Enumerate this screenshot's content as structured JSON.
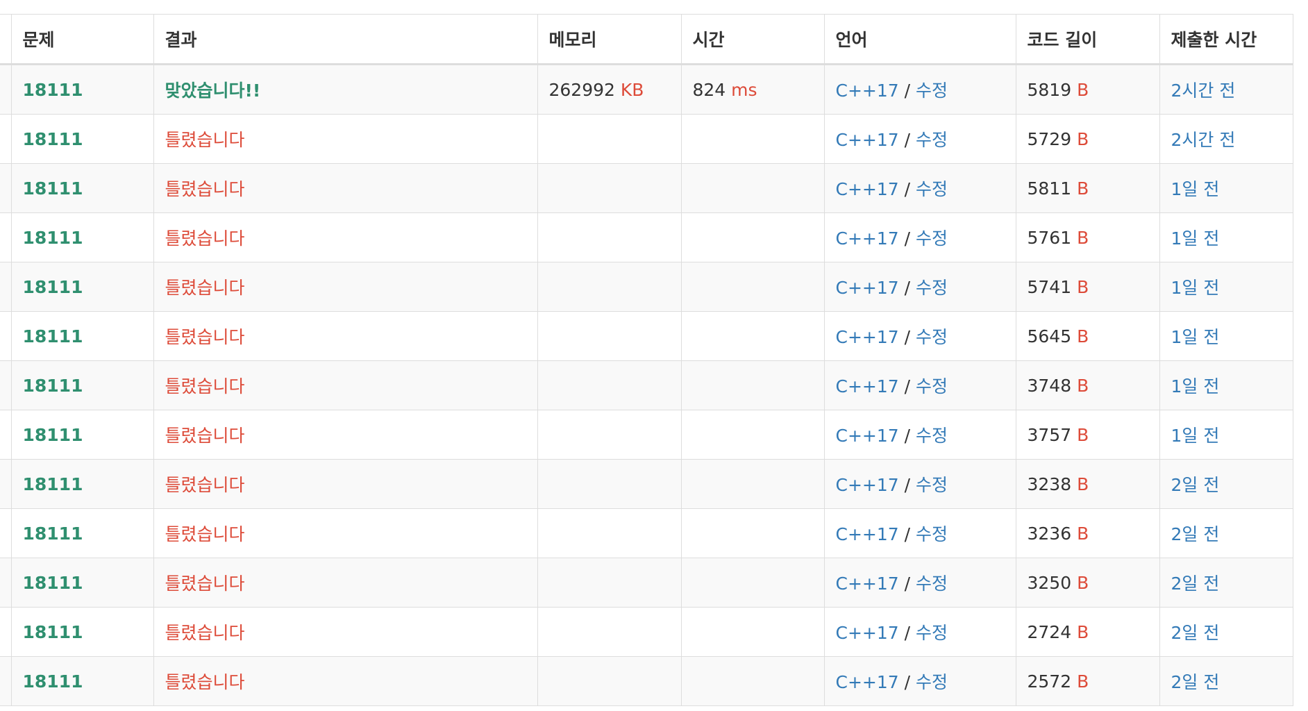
{
  "headers": [
    "",
    "문제",
    "결과",
    "메모리",
    "시간",
    "언어",
    "코드 길이",
    "제출한 시간"
  ],
  "colors": {
    "accent_green": "#2f8f6f",
    "error_red": "#dd4b39",
    "link_blue": "#337ab7",
    "border": "#dddddd",
    "stripe": "#f9f9f9"
  },
  "rows": [
    {
      "problem": "18111",
      "result": "맞았습니다!!",
      "status": "accepted",
      "memory": "262992",
      "memory_unit": "KB",
      "time": "824",
      "time_unit": "ms",
      "language": "C++17",
      "separator": "/",
      "edit": "수정",
      "code_length": "5819",
      "code_unit": "B",
      "submitted": "2시간 전"
    },
    {
      "problem": "18111",
      "result": "틀렸습니다",
      "status": "wrong",
      "memory": "",
      "memory_unit": "",
      "time": "",
      "time_unit": "",
      "language": "C++17",
      "separator": "/",
      "edit": "수정",
      "code_length": "5729",
      "code_unit": "B",
      "submitted": "2시간 전"
    },
    {
      "problem": "18111",
      "result": "틀렸습니다",
      "status": "wrong",
      "memory": "",
      "memory_unit": "",
      "time": "",
      "time_unit": "",
      "language": "C++17",
      "separator": "/",
      "edit": "수정",
      "code_length": "5811",
      "code_unit": "B",
      "submitted": "1일 전"
    },
    {
      "problem": "18111",
      "result": "틀렸습니다",
      "status": "wrong",
      "memory": "",
      "memory_unit": "",
      "time": "",
      "time_unit": "",
      "language": "C++17",
      "separator": "/",
      "edit": "수정",
      "code_length": "5761",
      "code_unit": "B",
      "submitted": "1일 전"
    },
    {
      "problem": "18111",
      "result": "틀렸습니다",
      "status": "wrong",
      "memory": "",
      "memory_unit": "",
      "time": "",
      "time_unit": "",
      "language": "C++17",
      "separator": "/",
      "edit": "수정",
      "code_length": "5741",
      "code_unit": "B",
      "submitted": "1일 전"
    },
    {
      "problem": "18111",
      "result": "틀렸습니다",
      "status": "wrong",
      "memory": "",
      "memory_unit": "",
      "time": "",
      "time_unit": "",
      "language": "C++17",
      "separator": "/",
      "edit": "수정",
      "code_length": "5645",
      "code_unit": "B",
      "submitted": "1일 전"
    },
    {
      "problem": "18111",
      "result": "틀렸습니다",
      "status": "wrong",
      "memory": "",
      "memory_unit": "",
      "time": "",
      "time_unit": "",
      "language": "C++17",
      "separator": "/",
      "edit": "수정",
      "code_length": "3748",
      "code_unit": "B",
      "submitted": "1일 전"
    },
    {
      "problem": "18111",
      "result": "틀렸습니다",
      "status": "wrong",
      "memory": "",
      "memory_unit": "",
      "time": "",
      "time_unit": "",
      "language": "C++17",
      "separator": "/",
      "edit": "수정",
      "code_length": "3757",
      "code_unit": "B",
      "submitted": "1일 전"
    },
    {
      "problem": "18111",
      "result": "틀렸습니다",
      "status": "wrong",
      "memory": "",
      "memory_unit": "",
      "time": "",
      "time_unit": "",
      "language": "C++17",
      "separator": "/",
      "edit": "수정",
      "code_length": "3238",
      "code_unit": "B",
      "submitted": "2일 전"
    },
    {
      "problem": "18111",
      "result": "틀렸습니다",
      "status": "wrong",
      "memory": "",
      "memory_unit": "",
      "time": "",
      "time_unit": "",
      "language": "C++17",
      "separator": "/",
      "edit": "수정",
      "code_length": "3236",
      "code_unit": "B",
      "submitted": "2일 전"
    },
    {
      "problem": "18111",
      "result": "틀렸습니다",
      "status": "wrong",
      "memory": "",
      "memory_unit": "",
      "time": "",
      "time_unit": "",
      "language": "C++17",
      "separator": "/",
      "edit": "수정",
      "code_length": "3250",
      "code_unit": "B",
      "submitted": "2일 전"
    },
    {
      "problem": "18111",
      "result": "틀렸습니다",
      "status": "wrong",
      "memory": "",
      "memory_unit": "",
      "time": "",
      "time_unit": "",
      "language": "C++17",
      "separator": "/",
      "edit": "수정",
      "code_length": "2724",
      "code_unit": "B",
      "submitted": "2일 전"
    },
    {
      "problem": "18111",
      "result": "틀렸습니다",
      "status": "wrong",
      "memory": "",
      "memory_unit": "",
      "time": "",
      "time_unit": "",
      "language": "C++17",
      "separator": "/",
      "edit": "수정",
      "code_length": "2572",
      "code_unit": "B",
      "submitted": "2일 전"
    }
  ]
}
